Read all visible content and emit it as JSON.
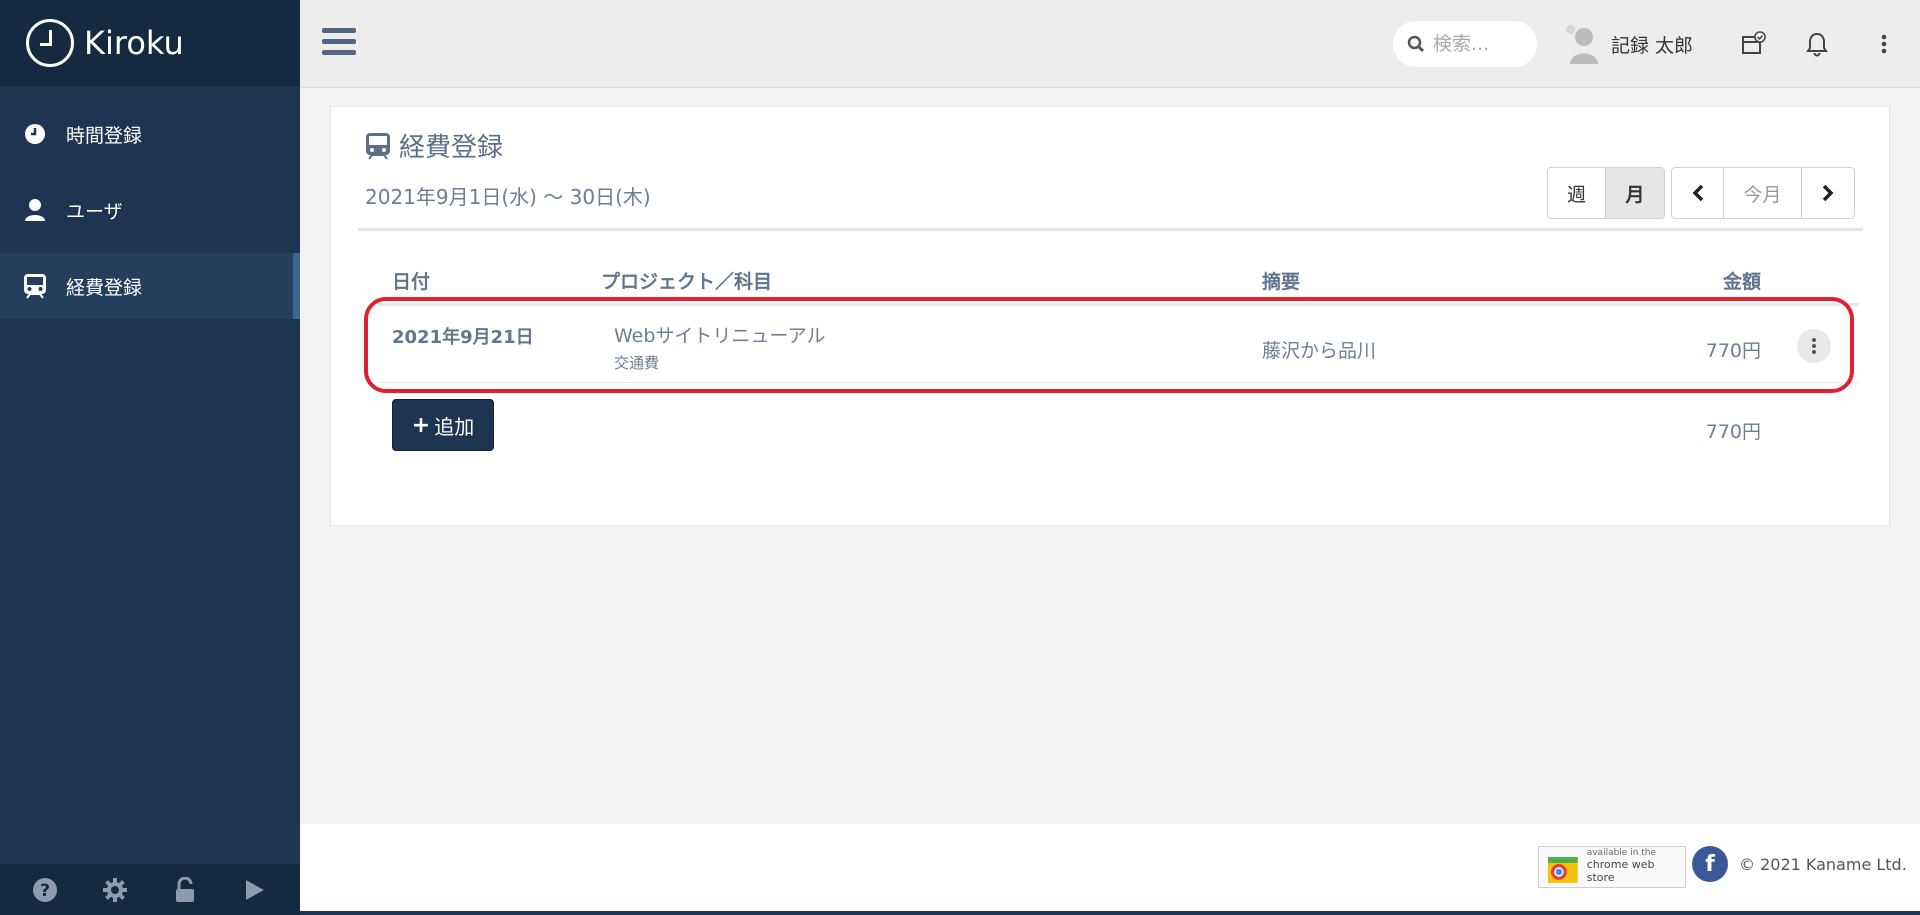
{
  "app": {
    "brand": "Kiroku"
  },
  "sidebar": {
    "items": [
      {
        "label": "時間登録",
        "icon": "clock-icon",
        "active": false
      },
      {
        "label": "ユーザ",
        "icon": "user-icon",
        "active": false
      },
      {
        "label": "経費登録",
        "icon": "train-icon",
        "active": true
      }
    ],
    "footer_icons": [
      "help-icon",
      "gear-icon",
      "unlock-icon",
      "play-icon"
    ]
  },
  "topbar": {
    "search_placeholder": "検索...",
    "user_name": "記録 太郎"
  },
  "panel": {
    "title": "経費登録",
    "range": "2021年9月1日(水) ～ 30日(木)",
    "view_buttons": {
      "week": "週",
      "month": "月",
      "active": "month"
    },
    "nav_buttons": {
      "prev": "‹",
      "today": "今月",
      "next": "›"
    },
    "columns": {
      "date": "日付",
      "project": "プロジェクト／科目",
      "summary": "摘要",
      "amount": "金額"
    },
    "rows": [
      {
        "date": "2021年9月21日",
        "project": "Webサイトリニューアル",
        "category": "交通費",
        "summary": "藤沢から品川",
        "amount": "770円"
      }
    ],
    "add_label": "追加",
    "total": "770円"
  },
  "footer": {
    "cws_small": "available in the",
    "cws_large": "chrome web store",
    "copyright": "© 2021 Kaname Ltd."
  },
  "colors": {
    "sidebar": "#1d3550",
    "highlight": "#e0202e",
    "accent": "#3f6690"
  }
}
